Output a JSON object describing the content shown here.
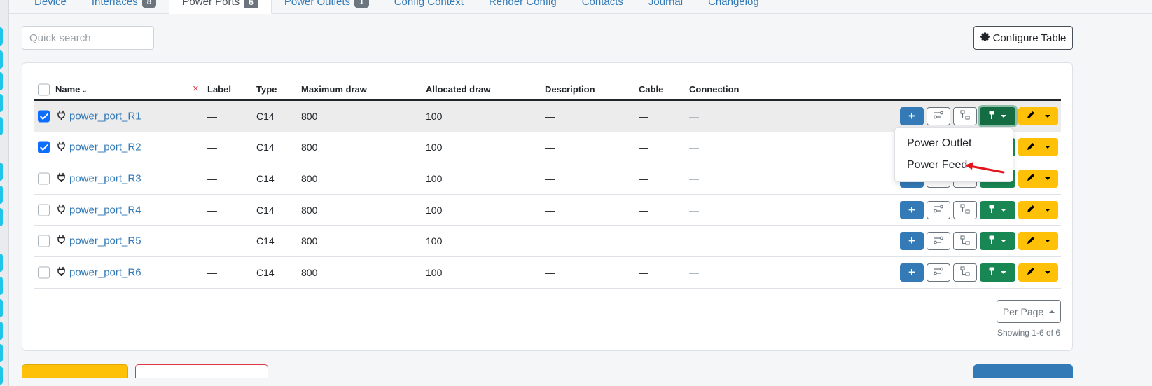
{
  "tabs": [
    {
      "label": "Device",
      "badge": null,
      "active": false
    },
    {
      "label": "Interfaces",
      "badge": "8",
      "active": false
    },
    {
      "label": "Power Ports",
      "badge": "6",
      "active": true
    },
    {
      "label": "Power Outlets",
      "badge": "1",
      "active": false
    },
    {
      "label": "Config Context",
      "badge": null,
      "active": false
    },
    {
      "label": "Render Config",
      "badge": null,
      "active": false
    },
    {
      "label": "Contacts",
      "badge": null,
      "active": false
    },
    {
      "label": "Journal",
      "badge": null,
      "active": false
    },
    {
      "label": "Changelog",
      "badge": null,
      "active": false
    }
  ],
  "toolbar": {
    "search_placeholder": "Quick search",
    "configure_label": "Configure Table",
    "configure_icon": "gear-icon"
  },
  "table": {
    "columns": {
      "name": "Name",
      "label": "Label",
      "type": "Type",
      "maximum_draw": "Maximum draw",
      "allocated_draw": "Allocated draw",
      "description": "Description",
      "cable": "Cable",
      "connection": "Connection"
    },
    "clear_filter_icon": "×",
    "rows": [
      {
        "checked": true,
        "name": "power_port_R1",
        "label": "—",
        "type": "C14",
        "maximum_draw": "800",
        "allocated_draw": "100",
        "description": "—",
        "cable": "—",
        "connection": "—"
      },
      {
        "checked": true,
        "name": "power_port_R2",
        "label": "—",
        "type": "C14",
        "maximum_draw": "800",
        "allocated_draw": "100",
        "description": "—",
        "cable": "—",
        "connection": "—"
      },
      {
        "checked": false,
        "name": "power_port_R3",
        "label": "—",
        "type": "C14",
        "maximum_draw": "800",
        "allocated_draw": "100",
        "description": "—",
        "cable": "—",
        "connection": "—"
      },
      {
        "checked": false,
        "name": "power_port_R4",
        "label": "—",
        "type": "C14",
        "maximum_draw": "800",
        "allocated_draw": "100",
        "description": "—",
        "cable": "—",
        "connection": "—"
      },
      {
        "checked": false,
        "name": "power_port_R5",
        "label": "—",
        "type": "C14",
        "maximum_draw": "800",
        "allocated_draw": "100",
        "description": "—",
        "cable": "—",
        "connection": "—"
      },
      {
        "checked": false,
        "name": "power_port_R6",
        "label": "—",
        "type": "C14",
        "maximum_draw": "800",
        "allocated_draw": "100",
        "description": "—",
        "cable": "—",
        "connection": "—"
      }
    ]
  },
  "connect_dropdown": {
    "items": [
      "Power Outlet",
      "Power Feed"
    ]
  },
  "footer": {
    "per_page_label": "Per Page",
    "showing_text": "Showing 1-6 of 6"
  },
  "colors": {
    "link": "#337ab7",
    "primary": "#337ab7",
    "success": "#198754",
    "warning": "#ffc107",
    "annotation_arrow": "#e3141b",
    "left_strip_accent": "#1fc6ea"
  }
}
